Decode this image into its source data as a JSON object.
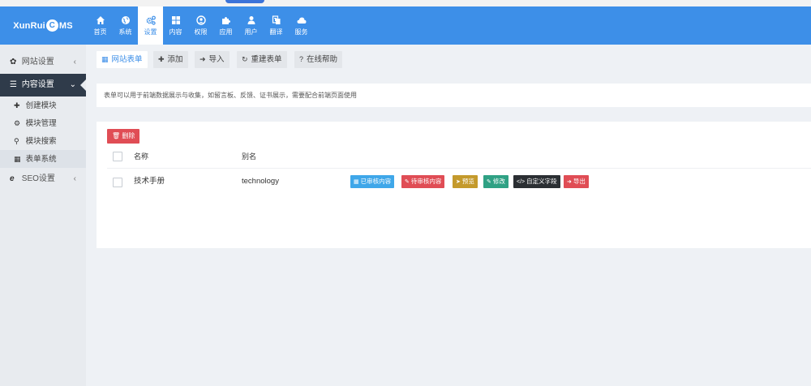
{
  "header": {
    "logo": {
      "prefix": "XunRui",
      "c_letter": "C",
      "suffix": "MS"
    },
    "nav": [
      {
        "label": "首页",
        "icon": "home-icon"
      },
      {
        "label": "系统",
        "icon": "globe-icon"
      },
      {
        "label": "设置",
        "icon": "cogs-icon",
        "active": true
      },
      {
        "label": "内容",
        "icon": "grid-icon"
      },
      {
        "label": "权限",
        "icon": "user-circle-icon"
      },
      {
        "label": "应用",
        "icon": "puzzle-icon"
      },
      {
        "label": "用户",
        "icon": "user-icon"
      },
      {
        "label": "翻译",
        "icon": "translate-icon"
      },
      {
        "label": "服务",
        "icon": "cloud-icon"
      }
    ]
  },
  "sidebar": {
    "website_settings": "网站设置",
    "content_settings": "内容设置",
    "sub_items": [
      {
        "label": "创建模块",
        "icon": "plus-icon"
      },
      {
        "label": "模块管理",
        "icon": "cogs-icon"
      },
      {
        "label": "模块搜索",
        "icon": "search-icon"
      },
      {
        "label": "表单系统",
        "icon": "table-icon"
      }
    ],
    "seo_settings": "SEO设置"
  },
  "toolbar": {
    "site_forms": "网站表单",
    "add": "添加",
    "import": "导入",
    "rebuild": "重建表单",
    "help": "在线帮助"
  },
  "note": "表单可以用于前端数据展示与收集，如留言板、反馈、证书展示，需要配合前端页面使用",
  "table": {
    "delete_label": "删除",
    "col_name": "名称",
    "col_alias": "别名",
    "rows": [
      {
        "name": "技术手册",
        "alias": "technology",
        "actions": {
          "approved": "已审核内容",
          "pending": "待审核内容",
          "preview": "预览",
          "edit": "修改",
          "custom_fields": "自定义字段",
          "export": "导出"
        }
      }
    ]
  },
  "colors": {
    "brand": "#3d8fe8",
    "sidebar_active": "#2f3b4a",
    "danger": "#e04d55",
    "info": "#3fa7e9",
    "warning": "#c49a2c",
    "success": "#2fa184",
    "dark": "#2b2f33"
  }
}
